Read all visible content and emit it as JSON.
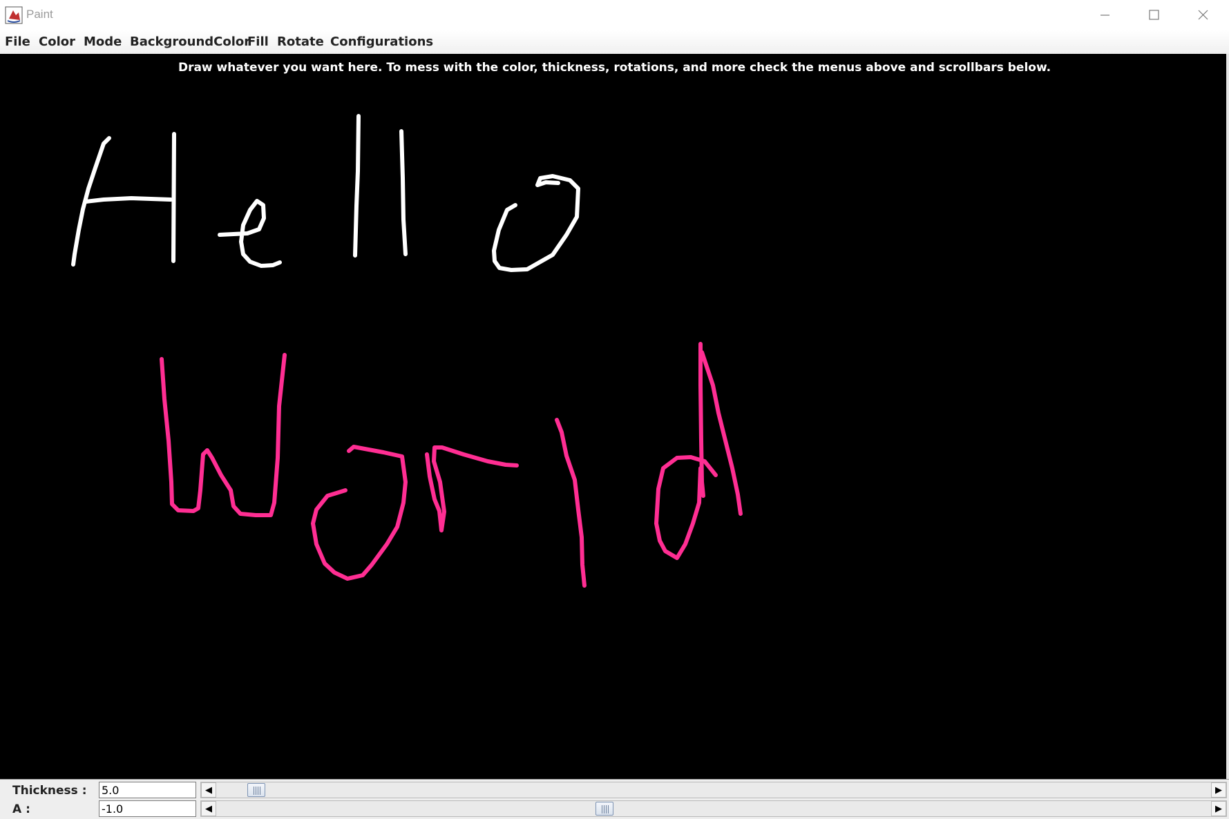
{
  "window": {
    "title": "Paint",
    "app_icon": "java-coffee-icon",
    "controls": [
      "minimize-icon",
      "maximize-icon",
      "close-icon"
    ]
  },
  "menu": {
    "items": [
      "File",
      "Color",
      "Mode",
      "BackgroundColor",
      "Fill",
      "Rotate",
      "Configurations"
    ]
  },
  "canvas": {
    "background": "#000000",
    "hint": "Draw whatever you want here. To mess with the color, thickness, rotations, and more check the menus above and scrollbars below.",
    "stroke_colors": {
      "hello": "#ffffff",
      "world": "#ff2e93"
    }
  },
  "controls": {
    "thickness": {
      "label": "Thickness :",
      "value": "5.0",
      "slider_fraction": 0.04
    },
    "a": {
      "label": "A :",
      "value": "-1.0",
      "slider_fraction": 0.39
    }
  }
}
